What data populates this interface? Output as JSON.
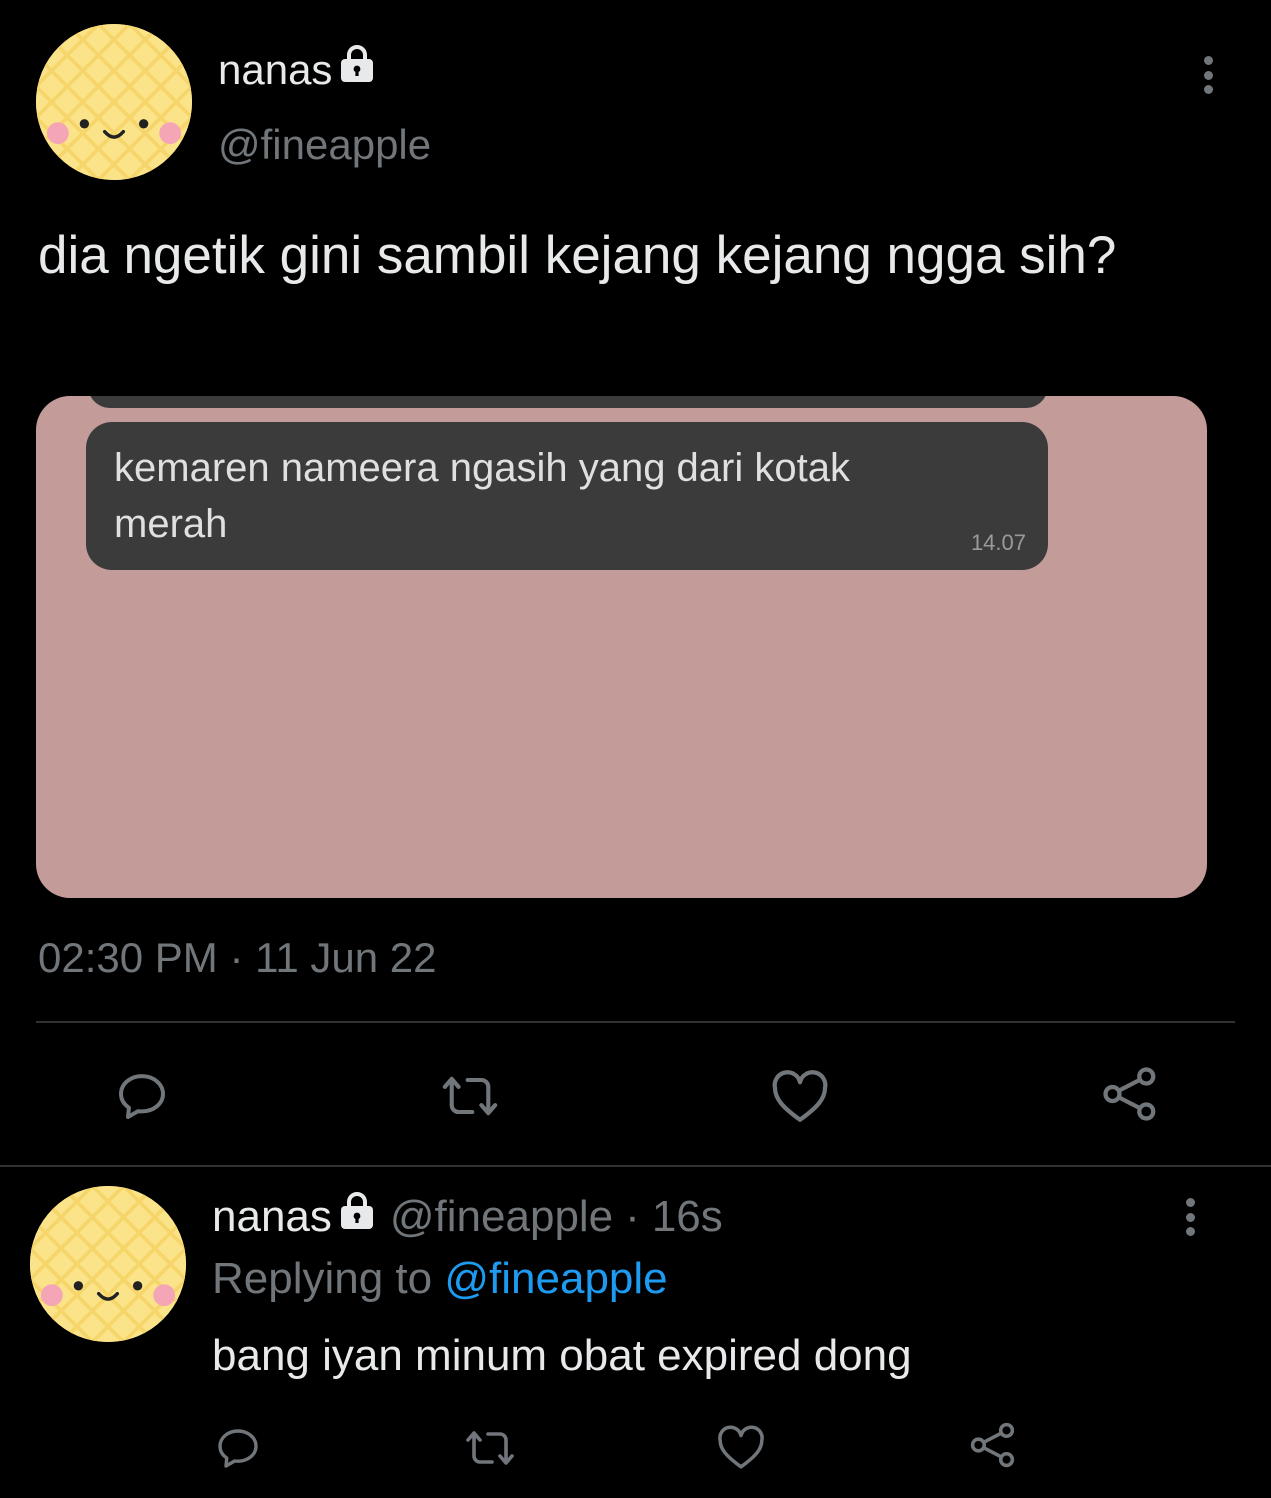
{
  "main_tweet": {
    "author_name": "nanas",
    "author_handle": "@fineapple",
    "text": "dia ngetik gini sambil kejang kejang ngga sih?",
    "media": {
      "message_text": "kemaren nameera ngasih yang dari kotak merah",
      "message_time": "14.07"
    },
    "timestamp": "02:30 PM · 11 Jun 22"
  },
  "reply_tweet": {
    "author_name": "nanas",
    "author_handle": "@fineapple",
    "time_ago": "16s",
    "replying_prefix": "Replying to",
    "replying_to": "@fineapple",
    "text": "bang iyan minum obat expired dong"
  },
  "icons": {
    "lock": "lock-icon",
    "more": "more-vertical-icon",
    "reply": "reply-icon",
    "retweet": "retweet-icon",
    "like": "heart-icon",
    "share": "share-icon"
  },
  "colors": {
    "background": "#000000",
    "primary_text": "#e7e9ea",
    "secondary_text": "#71767b",
    "link": "#1d9bf0",
    "divider": "#2f3336",
    "media_background": "#c39c9a",
    "bubble": "#3b3b3b"
  }
}
